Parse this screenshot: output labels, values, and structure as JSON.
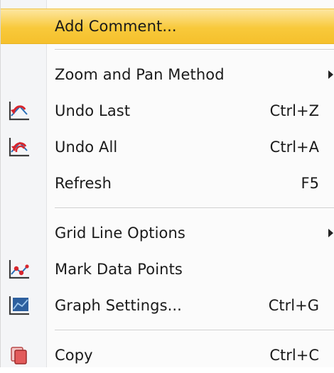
{
  "menu": {
    "items": [
      {
        "label": "Add Comment...",
        "shortcut": "",
        "icon": "",
        "submenu": false
      },
      {
        "label": "Zoom and Pan Method",
        "shortcut": "",
        "icon": "",
        "submenu": true
      },
      {
        "label": "Undo Last",
        "shortcut": "Ctrl+Z",
        "icon": "undo-last-icon",
        "submenu": false
      },
      {
        "label": "Undo All",
        "shortcut": "Ctrl+A",
        "icon": "undo-all-icon",
        "submenu": false
      },
      {
        "label": "Refresh",
        "shortcut": "F5",
        "icon": "",
        "submenu": false
      },
      {
        "label": "Grid Line Options",
        "shortcut": "",
        "icon": "",
        "submenu": true
      },
      {
        "label": "Mark Data Points",
        "shortcut": "",
        "icon": "mark-data-points-icon",
        "submenu": false
      },
      {
        "label": "Graph Settings...",
        "shortcut": "Ctrl+G",
        "icon": "graph-settings-icon",
        "submenu": false
      },
      {
        "label": "Copy",
        "shortcut": "Ctrl+C",
        "icon": "copy-icon",
        "submenu": false
      }
    ]
  },
  "colors": {
    "highlight": "#f8c93b",
    "gutter": "#f4f5f7",
    "icon_red": "#d8262d",
    "icon_blue": "#2a6fb8"
  }
}
